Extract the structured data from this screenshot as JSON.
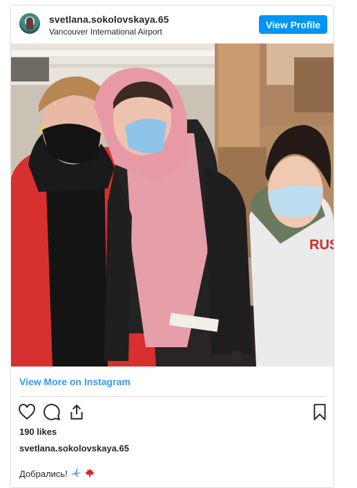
{
  "post": {
    "username": "svetlana.sokolovskaya.65",
    "location": "Vancouver International Airport",
    "view_profile_label": "View Profile",
    "view_more_label": "View More on Instagram",
    "likes": "190 likes",
    "caption_user": "svetlana.sokolovskaya.65",
    "caption_text": "Добрались!",
    "caption_emojis": [
      "airplane-emoji",
      "maple-leaf-emoji"
    ],
    "photo_jacket_print": "RUS"
  },
  "colors": {
    "accent": "#0095f6",
    "link": "#3897f0",
    "border": "#dbdbdb",
    "text": "#262626"
  },
  "icons": [
    "heart-icon",
    "comment-icon",
    "share-icon",
    "bookmark-icon"
  ]
}
